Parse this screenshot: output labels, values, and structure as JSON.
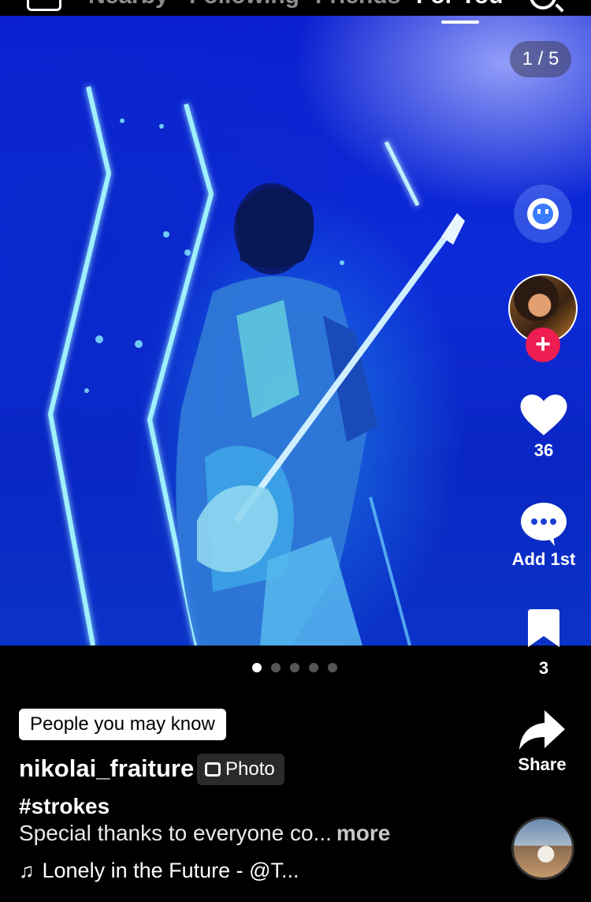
{
  "top_nav": {
    "tabs": [
      {
        "label": "Nearby"
      },
      {
        "label": "Following"
      },
      {
        "label": "Friends"
      },
      {
        "label": "For You",
        "active": true
      }
    ]
  },
  "photo": {
    "counter": "1 / 5",
    "page_index": 1,
    "page_count": 5
  },
  "actions": {
    "likes": "36",
    "comments_label": "Add 1st",
    "saves": "3",
    "share_label": "Share"
  },
  "post": {
    "badge": "People you may know",
    "username": "nikolai_fraiture",
    "type_badge": "Photo",
    "hashtag": "#strokes",
    "caption": "Special thanks to everyone co...",
    "more_label": "more",
    "music": "Lonely in the Future - @T..."
  },
  "colors": {
    "accent_red": "#ee1d52",
    "background": "#000000",
    "photo_blue": "#0b1fd0"
  },
  "icons": [
    "live-icon",
    "search-icon",
    "assistant-icon",
    "plus-icon",
    "heart-icon",
    "comment-icon",
    "bookmark-icon",
    "share-icon",
    "music-note-icon",
    "photo-icon"
  ]
}
